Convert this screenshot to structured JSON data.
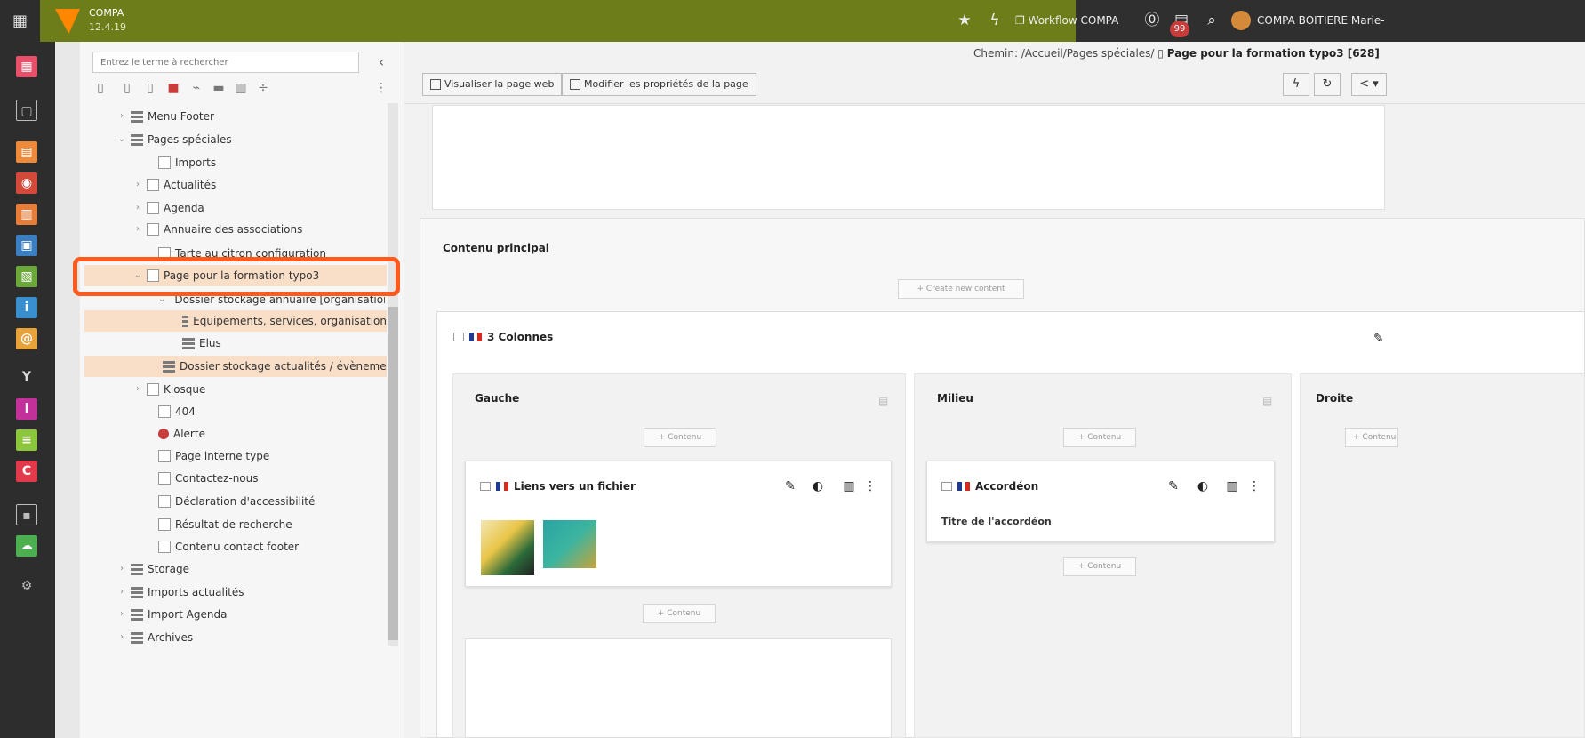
{
  "topbar": {
    "site_name": "COMPA",
    "version": "12.4.19",
    "workflow_label": "Workflow COMPA",
    "notification_count": "99",
    "user_name": "COMPA BOITIERE Marie-"
  },
  "tree": {
    "search_placeholder": "Entrez le terme à rechercher",
    "nodes": [
      {
        "label": "Menu Footer"
      },
      {
        "label": "Pages spéciales"
      },
      {
        "label": "Imports"
      },
      {
        "label": "Actualités"
      },
      {
        "label": "Agenda"
      },
      {
        "label": "Annuaire des associations"
      },
      {
        "label": "Tarte au citron configuration"
      },
      {
        "label": "Page pour la formation typo3"
      },
      {
        "label": "Dossier stockage annuaire [organisation"
      },
      {
        "label": "Equipements, services, organisation"
      },
      {
        "label": "Elus"
      },
      {
        "label": "Dossier stockage actualités / évèneme"
      },
      {
        "label": "Kiosque"
      },
      {
        "label": "404"
      },
      {
        "label": "Alerte"
      },
      {
        "label": "Page interne type"
      },
      {
        "label": "Contactez-nous"
      },
      {
        "label": "Déclaration d'accessibilité"
      },
      {
        "label": "Résultat de recherche"
      },
      {
        "label": "Contenu contact footer"
      },
      {
        "label": "Storage"
      },
      {
        "label": "Imports actualités"
      },
      {
        "label": "Import Agenda"
      },
      {
        "label": "Archives"
      }
    ]
  },
  "main": {
    "breadcrumb_prefix": "Chemin: /Accueil/Pages spéciales/",
    "breadcrumb_page": "Page pour la formation typo3 [628]",
    "view_page_label": "Visualiser la page web",
    "edit_props_label": "Modifier les propriétés de la page",
    "section_title": "Contenu principal",
    "create_content_label": "Create new content",
    "grid_title": "3 Colonnes",
    "content_btn_label": "Contenu",
    "columns": [
      {
        "title": "Gauche"
      },
      {
        "title": "Milieu"
      },
      {
        "title": "Droite"
      }
    ],
    "ce_file": {
      "title": "Liens vers un fichier"
    },
    "ce_accordion": {
      "title": "Accordéon",
      "body": "Titre de l'accordéon"
    }
  },
  "colors": {
    "topbar": "#6c7d19",
    "selection": "#f9dec8",
    "highlight": "#ff5a1e"
  }
}
